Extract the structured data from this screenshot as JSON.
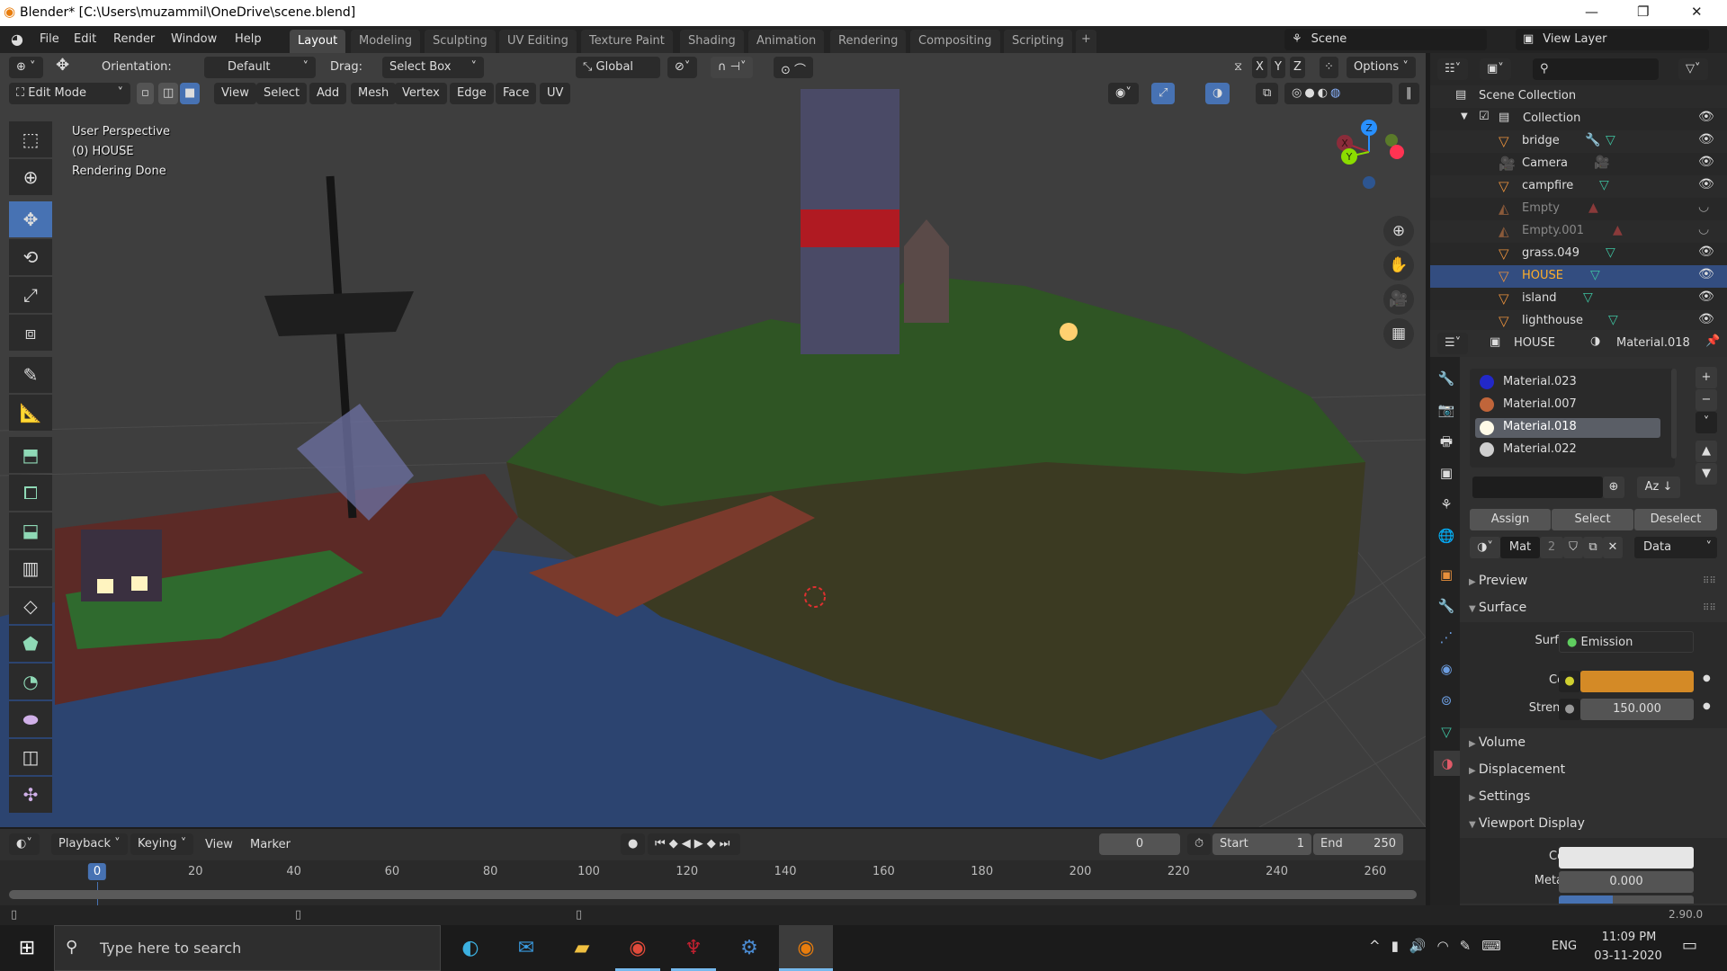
{
  "window": {
    "title": "Blender* [C:\\Users\\muzammil\\OneDrive\\scene.blend]",
    "minimize": "—",
    "restore": "❐",
    "close": "✕"
  },
  "menu": {
    "items": [
      "File",
      "Edit",
      "Render",
      "Window",
      "Help"
    ]
  },
  "workspaces": {
    "tabs": [
      "Layout",
      "Modeling",
      "Sculpting",
      "UV Editing",
      "Texture Paint",
      "Shading",
      "Animation",
      "Rendering",
      "Compositing",
      "Scripting"
    ],
    "active": "Layout",
    "add": "+"
  },
  "scene": {
    "name": "Scene",
    "view_layer": "View Layer"
  },
  "viewport_header": {
    "orientation_label": "Orientation:",
    "orientation_value": "Default",
    "drag_label": "Drag:",
    "drag_value": "Select Box",
    "transform_orientation": "Global",
    "axis_x": "X",
    "axis_y": "Y",
    "axis_z": "Z",
    "options": "Options",
    "mode": "Edit Mode",
    "menus": [
      "View",
      "Select",
      "Add",
      "Mesh",
      "Vertex",
      "Edge",
      "Face",
      "UV"
    ]
  },
  "overlay": {
    "line1": "User Perspective",
    "line2": "(0) HOUSE",
    "line3": "Rendering Done"
  },
  "gizmo": {
    "x": "X",
    "y": "Y",
    "z": "Z",
    "colors": {
      "x": "#ff3352",
      "y": "#8bdc00",
      "z": "#2890ff"
    }
  },
  "toolbar": {
    "tools": [
      "select-box",
      "cursor",
      "move",
      "rotate",
      "scale",
      "transform",
      "annotate",
      "measure",
      "extrude",
      "inset",
      "bevel",
      "loop-cut",
      "knife",
      "poly-build",
      "spin",
      "smooth",
      "edge-slide",
      "shrink-fatten"
    ],
    "active": "move"
  },
  "outliner": {
    "root": "Scene Collection",
    "collection": "Collection",
    "items": [
      {
        "name": "bridge",
        "type": "mesh",
        "visible": true,
        "modifier": true
      },
      {
        "name": "Camera",
        "type": "camera",
        "visible": true
      },
      {
        "name": "campfire",
        "type": "mesh",
        "visible": true
      },
      {
        "name": "Empty",
        "type": "empty",
        "visible": false
      },
      {
        "name": "Empty.001",
        "type": "empty",
        "visible": false
      },
      {
        "name": "grass.049",
        "type": "mesh",
        "visible": true
      },
      {
        "name": "HOUSE",
        "type": "mesh",
        "visible": true,
        "selected": true
      },
      {
        "name": "island",
        "type": "mesh",
        "visible": true
      },
      {
        "name": "lighthouse",
        "type": "mesh",
        "visible": true
      }
    ]
  },
  "properties": {
    "object": "HOUSE",
    "material": "Material.018",
    "slots": [
      {
        "name": "Material.023",
        "color": "#2228c8"
      },
      {
        "name": "Material.007",
        "color": "#c0653a"
      },
      {
        "name": "Material.018",
        "color": "#fffbe8",
        "selected": true
      },
      {
        "name": "Material.022",
        "color": "#cfcfcf"
      }
    ],
    "buttons": {
      "assign": "Assign",
      "select": "Select",
      "deselect": "Deselect"
    },
    "mat_name": "Mat",
    "users": "2",
    "link": "Data",
    "panels": {
      "preview": "Preview",
      "surface": "Surface",
      "volume": "Volume",
      "displacement": "Displacement",
      "settings": "Settings",
      "viewport_display": "Viewport Display"
    },
    "surface": {
      "label": "Surface",
      "value": "Emission",
      "color_label": "Color",
      "color": "#d48a26",
      "strength_label": "Strength",
      "strength": "150.000"
    },
    "viewport_display": {
      "color_label": "Color",
      "color": "#e6e6e6",
      "metallic_label": "Metallic",
      "metallic": "0.000",
      "roughness": 0.4
    }
  },
  "timeline": {
    "menus": [
      "Playback",
      "Keying",
      "View",
      "Marker"
    ],
    "current_frame": "0",
    "start_label": "Start",
    "start": "1",
    "end_label": "End",
    "end": "250",
    "ticks": [
      "0",
      "20",
      "40",
      "60",
      "80",
      "100",
      "120",
      "140",
      "160",
      "180",
      "200",
      "220",
      "240",
      "260"
    ]
  },
  "status": {
    "version": "2.90.0"
  },
  "taskbar": {
    "search_placeholder": "Type here to search",
    "time": "11:09 PM",
    "date": "03-11-2020",
    "lang": "ENG",
    "apps": [
      "edge",
      "mail",
      "file-explorer",
      "chrome",
      "game",
      "steam",
      "blender"
    ]
  }
}
